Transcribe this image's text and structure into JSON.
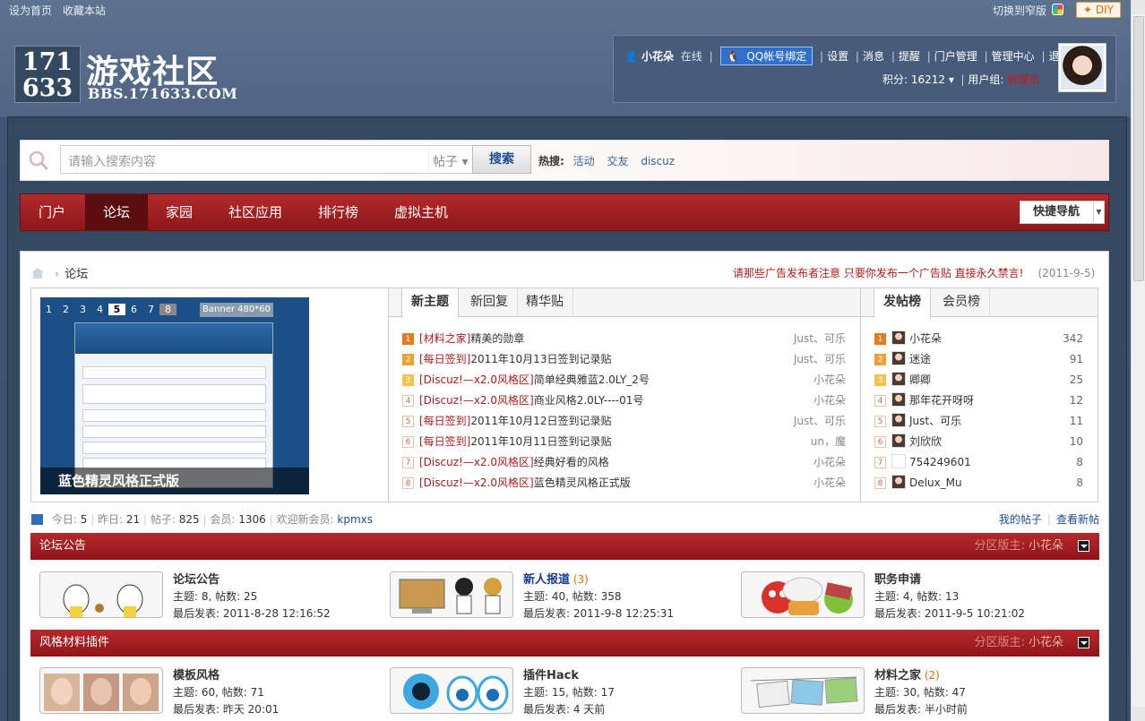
{
  "topbar": {
    "set_home": "设为首页",
    "bookmark": "收藏本站",
    "switch_width": "切换到窄版",
    "diy": "DIY"
  },
  "logo": {
    "number_line1": "171",
    "number_line2": "633",
    "title": "游戏社区",
    "url": "BBS.171633.COM"
  },
  "user": {
    "name": "小花朵",
    "status": "在线",
    "qq_bind": "QQ帐号绑定",
    "links": [
      "设置",
      "消息",
      "提醒",
      "门户管理",
      "管理中心",
      "退出"
    ],
    "points_label": "积分: 16212",
    "group_label": "用户组:",
    "group_value": "管理员"
  },
  "search": {
    "placeholder": "请输入搜索内容",
    "type": "帖子",
    "button": "搜索",
    "hot_label": "热搜:",
    "hot_keywords": [
      "活动",
      "交友",
      "discuz"
    ]
  },
  "nav": {
    "items": [
      "门户",
      "论坛",
      "家园",
      "社区应用",
      "排行榜",
      "虚拟主机"
    ],
    "active": "论坛",
    "quick_nav": "快捷导航"
  },
  "breadcrumb": {
    "current": "论坛"
  },
  "notice": {
    "text": "请那些广告发布者注意 只要你发布一个广告贴 直接永久禁言!",
    "date": "(2011-9-5)"
  },
  "slideshow": {
    "numbers": [
      "1",
      "2",
      "3",
      "4",
      "5",
      "6",
      "7",
      "8"
    ],
    "active": "5",
    "banner": "Banner 480*60",
    "caption": "蓝色精灵风格正式版"
  },
  "topics_tabs": [
    "新主题",
    "新回复",
    "精华贴"
  ],
  "topics": [
    {
      "rank": "1",
      "tag": "[材料之家]",
      "title": "精美的勋章",
      "author": "Just、可乐"
    },
    {
      "rank": "2",
      "tag": "[每日签到]",
      "title": "2011年10月13日签到记录贴",
      "author": "Just、可乐"
    },
    {
      "rank": "3",
      "tag": "[Discuz!—x2.0风格区]",
      "title": "简单经典雅蓝2.0LY_2号",
      "author": "小花朵"
    },
    {
      "rank": "4",
      "tag": "[Discuz!—x2.0风格区]",
      "title": "商业风格2.0LY----01号",
      "author": "小花朵"
    },
    {
      "rank": "5",
      "tag": "[每日签到]",
      "title": "2011年10月12日签到记录贴",
      "author": "Just、可乐"
    },
    {
      "rank": "6",
      "tag": "[每日签到]",
      "title": "2011年10月11日签到记录贴",
      "author": "un，魔"
    },
    {
      "rank": "7",
      "tag": "[Discuz!—x2.0风格区]",
      "title": "经典好看的风格",
      "author": "小花朵"
    },
    {
      "rank": "8",
      "tag": "[Discuz!—x2.0风格区]",
      "title": "蓝色精灵风格正式版",
      "author": "小花朵"
    }
  ],
  "rank_tabs": [
    "发帖榜",
    "会员榜"
  ],
  "ranking": [
    {
      "rank": "1",
      "name": "小花朵",
      "count": "342"
    },
    {
      "rank": "2",
      "name": "迷途",
      "count": "91"
    },
    {
      "rank": "3",
      "name": "卿卿",
      "count": "25"
    },
    {
      "rank": "4",
      "name": "那年花开呀呀",
      "count": "12"
    },
    {
      "rank": "5",
      "name": "Just、可乐",
      "count": "11"
    },
    {
      "rank": "6",
      "name": "刘欣欣",
      "count": "10"
    },
    {
      "rank": "7",
      "name": "754249601",
      "count": "8"
    },
    {
      "rank": "8",
      "name": "Delux_Mu",
      "count": "8"
    }
  ],
  "stats": {
    "today_label": "今日:",
    "today": "5",
    "yesterday_label": "昨日:",
    "yesterday": "21",
    "posts_label": "帖子:",
    "posts": "825",
    "members_label": "会员:",
    "members": "1306",
    "welcome_label": "欢迎新会员:",
    "new_member": "kpmxs",
    "my_posts": "我的帖子",
    "view_new": "查看新帖"
  },
  "sections": [
    {
      "title": "论坛公告",
      "mod_label": "分区版主:",
      "mod_name": "小花朵",
      "forums": [
        {
          "name": "论坛公告",
          "today": "",
          "topics": "主题: 8, 帖数: 25",
          "last": "最后发表: 2011-8-28 12:16:52"
        },
        {
          "name": "新人报道",
          "today": "(3)",
          "topics": "主题: 40, 帖数: 358",
          "last": "最后发表: 2011-9-8 12:25:31"
        },
        {
          "name": "职务申请",
          "today": "",
          "topics": "主题: 4, 帖数: 13",
          "last": "最后发表: 2011-9-5 10:21:02"
        }
      ]
    },
    {
      "title": "风格材料插件",
      "mod_label": "分区版主:",
      "mod_name": "小花朵",
      "forums": [
        {
          "name": "模板风格",
          "today": "",
          "topics": "主题: 60, 帖数: 71",
          "last": "最后发表: 昨天 20:01"
        },
        {
          "name": "插件Hack",
          "today": "",
          "topics": "主题: 15, 帖数: 17",
          "last": "最后发表: 4 天前"
        },
        {
          "name": "材料之家",
          "today": "(2)",
          "topics": "主题: 30, 帖数: 47",
          "last": "最后发表: 半小时前"
        }
      ]
    }
  ]
}
